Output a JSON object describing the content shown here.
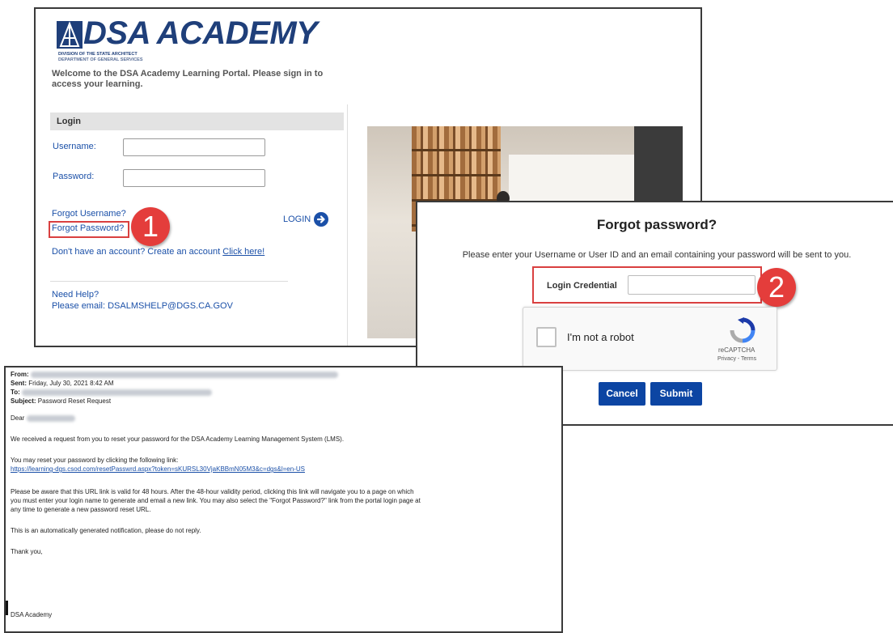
{
  "login": {
    "logo": "DSA ACADEMY",
    "logo_sub1": "DIVISION OF THE STATE ARCHITECT",
    "logo_sub2": "DEPARTMENT OF GENERAL SERVICES",
    "welcome": "Welcome to the DSA Academy Learning Portal. Please sign in to access your learning.",
    "section_title": "Login",
    "username_label": "Username:",
    "password_label": "Password:",
    "forgot_username": "Forgot Username?",
    "forgot_password": "Forgot Password?",
    "login_button": "LOGIN",
    "no_account": "Don't have an account? Create an account",
    "click_here": "Click here!",
    "need_help": "Need Help?",
    "help_email": "Please email: DSALMSHELP@DGS.CA.GOV"
  },
  "badges": {
    "step1": "1",
    "step2": "2"
  },
  "forgot": {
    "title": "Forgot password?",
    "description": "Please enter your Username or User ID and an email containing your password will be sent to you.",
    "credential_label": "Login Credential",
    "credential_value": "",
    "captcha_text": "I'm not a robot",
    "captcha_brand": "reCAPTCHA",
    "captcha_terms": "Privacy - Terms",
    "cancel_button": "Cancel",
    "submit_button": "Submit"
  },
  "email": {
    "from_label": "From:",
    "sent_label": "Sent:",
    "sent_value": "Friday, July 30, 2021 8:42 AM",
    "to_label": "To:",
    "subject_label": "Subject:",
    "subject_value": "Password Reset Request",
    "dear": "Dear",
    "p1": "We received a request from you to reset your password for the DSA Academy Learning Management System (LMS).",
    "p2": "You may reset your password by clicking the following link:",
    "link": "https://learning-dgs.csod.com/resetPasswrd.aspx?token=sKURSL30VjaKBBmN05M3&c=dgs&l=en-US",
    "p3_line1": "Please be aware that this URL link is valid for 48 hours. After the 48-hour validity period, clicking this link will navigate you to a page on which",
    "p3_line2": "you must enter your login name to generate and email a new link. You may also select the \"Forgot Password?\" link from the portal login page at",
    "p3_line3": "any time to generate a new password reset URL.",
    "p4": "This is an automatically generated notification, please do not reply.",
    "thanks": "Thank you,",
    "signature": "DSA Academy"
  },
  "colors": {
    "brand": "#1f3f7a",
    "link": "#1b50a8",
    "highlight": "#d94040",
    "button": "#0c45a3",
    "badge": "#e43d3b"
  }
}
